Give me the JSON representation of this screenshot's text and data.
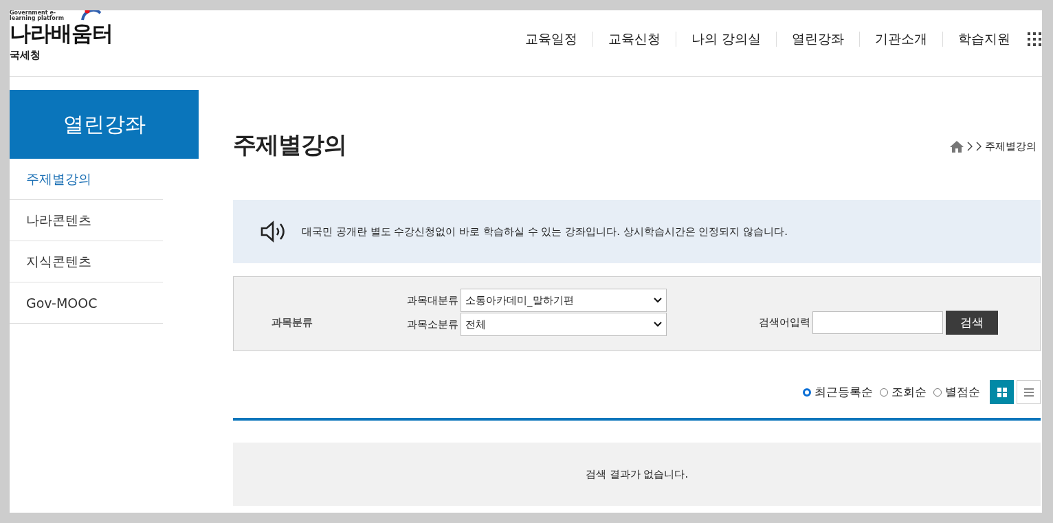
{
  "logo": {
    "tagline": "Government e-learning platform",
    "name": "나라배움터",
    "agency": "국세청"
  },
  "nav": [
    "교육일정",
    "교육신청",
    "나의 강의실",
    "열린강좌",
    "기관소개",
    "학습지원"
  ],
  "sidebar": {
    "title": "열린강좌",
    "items": [
      {
        "label": "주제별강의",
        "selected": true
      },
      {
        "label": "나라콘텐츠",
        "selected": false
      },
      {
        "label": "지식콘텐츠",
        "selected": false
      },
      {
        "label": "Gov-MOOC",
        "selected": false
      }
    ]
  },
  "page_title": "주제별강의",
  "breadcrumb": [
    "주제별강의"
  ],
  "notice": "대국민 공개란 별도 수강신청없이 바로 학습하실 수 있는 강좌입니다. 상시학습시간은 인정되지 않습니다.",
  "filter": {
    "label": "과목분류",
    "major": {
      "label": "과목대분류",
      "value": "소통아카데미_말하기편"
    },
    "minor": {
      "label": "과목소분류",
      "value": "전체"
    },
    "search": {
      "label": "검색어입력",
      "button": "검색"
    }
  },
  "sort": [
    {
      "label": "최근등록순",
      "selected": true
    },
    {
      "label": "조회순",
      "selected": false
    },
    {
      "label": "별점순",
      "selected": false
    }
  ],
  "views": [
    {
      "kind": "grid",
      "selected": true
    },
    {
      "kind": "list",
      "selected": false
    }
  ],
  "empty_message": "검색 결과가 없습니다."
}
